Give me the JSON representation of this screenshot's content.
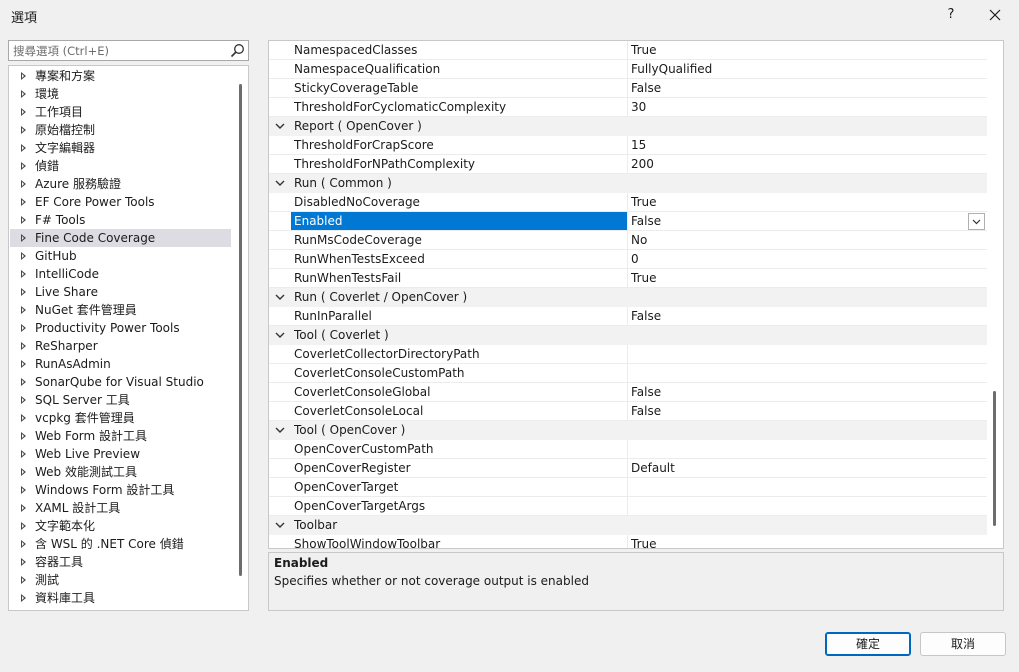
{
  "window": {
    "title": "選項",
    "help_label": "?"
  },
  "search": {
    "placeholder": "搜尋選項 (Ctrl+E)"
  },
  "tree": {
    "items": [
      {
        "label": "專案和方案"
      },
      {
        "label": "環境"
      },
      {
        "label": "工作項目"
      },
      {
        "label": "原始檔控制"
      },
      {
        "label": "文字編輯器"
      },
      {
        "label": "偵錯"
      },
      {
        "label": "Azure 服務驗證"
      },
      {
        "label": "EF Core Power Tools"
      },
      {
        "label": "F# Tools"
      },
      {
        "label": "Fine Code Coverage",
        "selected": true
      },
      {
        "label": "GitHub"
      },
      {
        "label": "IntelliCode"
      },
      {
        "label": "Live Share"
      },
      {
        "label": "NuGet 套件管理員"
      },
      {
        "label": "Productivity Power Tools"
      },
      {
        "label": "ReSharper"
      },
      {
        "label": "RunAsAdmin"
      },
      {
        "label": "SonarQube for Visual Studio"
      },
      {
        "label": "SQL Server 工具"
      },
      {
        "label": "vcpkg 套件管理員"
      },
      {
        "label": "Web Form 設計工具"
      },
      {
        "label": "Web Live Preview"
      },
      {
        "label": "Web 效能測試工具"
      },
      {
        "label": "Windows Form 設計工具"
      },
      {
        "label": "XAML 設計工具"
      },
      {
        "label": "文字範本化"
      },
      {
        "label": "含 WSL 的 .NET Core 偵錯"
      },
      {
        "label": "容器工具"
      },
      {
        "label": "測試"
      },
      {
        "label": "資料庫工具"
      }
    ]
  },
  "grid": {
    "rows": [
      {
        "kind": "prop",
        "name": "NamespacedClasses",
        "value": "True"
      },
      {
        "kind": "prop",
        "name": "NamespaceQualification",
        "value": "FullyQualified"
      },
      {
        "kind": "prop",
        "name": "StickyCoverageTable",
        "value": "False"
      },
      {
        "kind": "prop",
        "name": "ThresholdForCyclomaticComplexity",
        "value": "30"
      },
      {
        "kind": "cat",
        "name": "Report ( OpenCover )"
      },
      {
        "kind": "prop",
        "name": "ThresholdForCrapScore",
        "value": "15"
      },
      {
        "kind": "prop",
        "name": "ThresholdForNPathComplexity",
        "value": "200"
      },
      {
        "kind": "cat",
        "name": "Run ( Common )"
      },
      {
        "kind": "prop",
        "name": "DisabledNoCoverage",
        "value": "True"
      },
      {
        "kind": "prop",
        "name": "Enabled",
        "value": "False",
        "selected": true
      },
      {
        "kind": "prop",
        "name": "RunMsCodeCoverage",
        "value": "No"
      },
      {
        "kind": "prop",
        "name": "RunWhenTestsExceed",
        "value": "0"
      },
      {
        "kind": "prop",
        "name": "RunWhenTestsFail",
        "value": "True"
      },
      {
        "kind": "cat",
        "name": "Run ( Coverlet / OpenCover )"
      },
      {
        "kind": "prop",
        "name": "RunInParallel",
        "value": "False"
      },
      {
        "kind": "cat",
        "name": "Tool ( Coverlet )"
      },
      {
        "kind": "prop",
        "name": "CoverletCollectorDirectoryPath",
        "value": ""
      },
      {
        "kind": "prop",
        "name": "CoverletConsoleCustomPath",
        "value": ""
      },
      {
        "kind": "prop",
        "name": "CoverletConsoleGlobal",
        "value": "False"
      },
      {
        "kind": "prop",
        "name": "CoverletConsoleLocal",
        "value": "False"
      },
      {
        "kind": "cat",
        "name": "Tool ( OpenCover )"
      },
      {
        "kind": "prop",
        "name": "OpenCoverCustomPath",
        "value": ""
      },
      {
        "kind": "prop",
        "name": "OpenCoverRegister",
        "value": "Default"
      },
      {
        "kind": "prop",
        "name": "OpenCoverTarget",
        "value": ""
      },
      {
        "kind": "prop",
        "name": "OpenCoverTargetArgs",
        "value": ""
      },
      {
        "kind": "cat",
        "name": "Toolbar"
      },
      {
        "kind": "prop",
        "name": "ShowToolWindowToolbar",
        "value": "True"
      }
    ]
  },
  "description": {
    "title": "Enabled",
    "text": "Specifies whether or not coverage output is enabled"
  },
  "buttons": {
    "ok_label": "確定",
    "cancel_label": "取消"
  },
  "colors": {
    "selection": "#0078d4",
    "tree_selection": "#dcdce2",
    "category_bg": "#f2f2f2"
  }
}
